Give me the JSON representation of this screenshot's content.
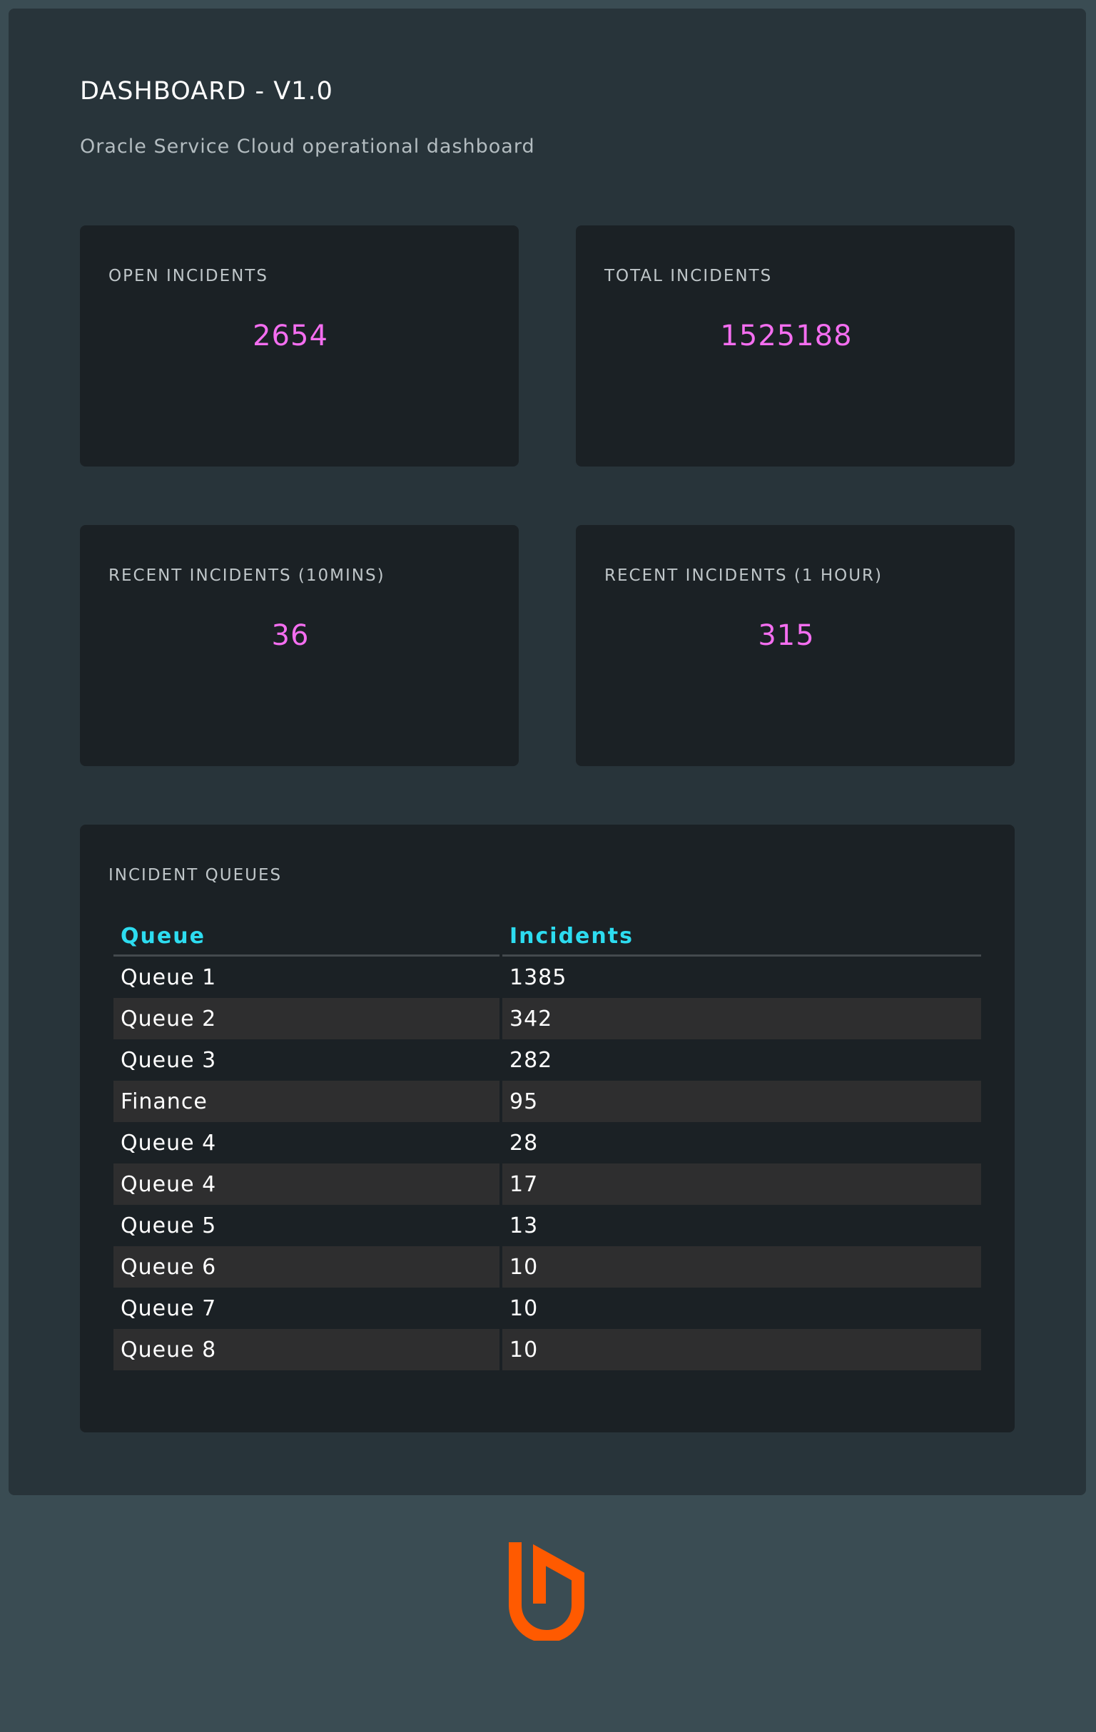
{
  "header": {
    "title": "DASHBOARD - V1.0",
    "subtitle": "Oracle Service Cloud operational dashboard"
  },
  "stats": {
    "open": {
      "label": "OPEN INCIDENTS",
      "value": "2654"
    },
    "total": {
      "label": "TOTAL INCIDENTS",
      "value": "1525188"
    },
    "recent_10m": {
      "label": "RECENT INCIDENTS (10MINS)",
      "value": "36"
    },
    "recent_1h": {
      "label": "RECENT INCIDENTS (1 HOUR)",
      "value": "315"
    }
  },
  "queues": {
    "label": "INCIDENT QUEUES",
    "columns": [
      "Queue",
      "Incidents"
    ],
    "rows": [
      {
        "queue": "Queue 1",
        "incidents": "1385"
      },
      {
        "queue": "Queue 2",
        "incidents": "342"
      },
      {
        "queue": "Queue 3",
        "incidents": "282"
      },
      {
        "queue": "Finance",
        "incidents": "95"
      },
      {
        "queue": "Queue 4",
        "incidents": "28"
      },
      {
        "queue": "Queue 4",
        "incidents": "17"
      },
      {
        "queue": "Queue 5",
        "incidents": "13"
      },
      {
        "queue": "Queue 6",
        "incidents": "10"
      },
      {
        "queue": "Queue 7",
        "incidents": "10"
      },
      {
        "queue": "Queue 8",
        "incidents": "10"
      }
    ]
  },
  "colors": {
    "accent_value": "#f46ef0",
    "table_header": "#2ddcf0",
    "logo": "#ff5a00"
  },
  "icons": {
    "logo": "shield-logo-icon"
  }
}
